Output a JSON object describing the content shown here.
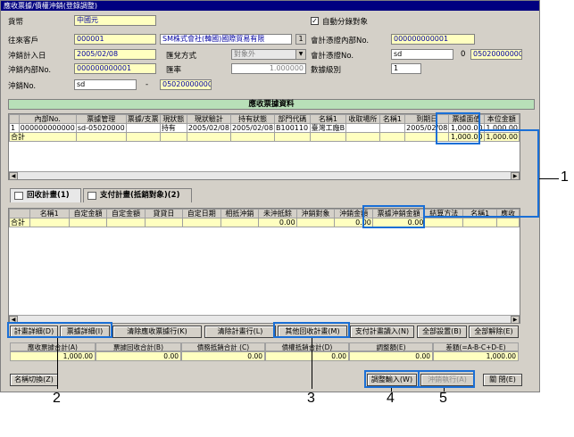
{
  "window": {
    "title": "應收票據/債權沖銷(登錄調整)"
  },
  "form": {
    "currency_label": "貨幣",
    "currency_value": "中國元",
    "auto_split_label": "自動分錄對象",
    "auto_split_checked": "✓",
    "client_label": "往來客戶",
    "client_code": "000001",
    "client_name": "SM株式會社(韓國)國際貿易有限",
    "accounting_no_label": "會計憑證內部No.",
    "accounting_no_value": "000000000001",
    "plan_date_label": "沖銷計入日",
    "plan_date_value": "2005/02/08",
    "exchange_method_label": "匯兌方式",
    "exchange_method_value": "對象外",
    "voucher_no_label": "會計憑證No.",
    "voucher_no_prefix": "sd",
    "voucher_sep": "0",
    "voucher_no_value": "050200000001",
    "write_off_no_label": "沖銷內部No.",
    "write_off_no_value": "000000000001",
    "rate_label": "匯率",
    "rate_value": "1.000000",
    "approval_label": "數據級別",
    "approval_value": "1",
    "offset_no_label": "沖銷No.",
    "offset_no_prefix": "sd",
    "offset_dash": "-",
    "offset_no_value": "050200000001"
  },
  "receivable": {
    "title": "應收票據資料",
    "headers": [
      "",
      "內部No.",
      "票據管理",
      "票據/支票",
      "現狀態",
      "現狀驗計",
      "持有狀態",
      "部門代碼",
      "名稱1",
      "收取場所",
      "名稱1",
      "到期日",
      "票據面值",
      "本位金額"
    ],
    "rows": [
      [
        "1",
        "000000000000",
        "sd-05020000",
        "",
        "持有",
        "2005/02/08",
        "2005/02/08",
        "B100110",
        "臺灣工廠B",
        "",
        "",
        "2005/02/08",
        "1,000.00",
        "1,000.00"
      ]
    ],
    "total_label": "合計",
    "total_face": "1,000.00",
    "total_base": "1,000.00"
  },
  "tabs": [
    {
      "label": "回收計畫(1)"
    },
    {
      "label": "支付計畫(抵銷對象)(2)"
    }
  ],
  "plan": {
    "headers": [
      "",
      "名稱1",
      "自定金額",
      "自定金額",
      "貸貸日",
      "自定日期",
      "相抵沖銷",
      "未沖抵餘",
      "沖銷對象",
      "沖銷金額",
      "票據沖銷金額",
      "結算方法",
      "名稱1",
      "應收"
    ],
    "total_label": "合計",
    "total_unwritten": "0.00",
    "total_writeoff": "0.00",
    "total_bill_writeoff": "0.00"
  },
  "buttons": {
    "plan_detail": "計畫詳細(D)",
    "bill_detail": "票據詳細(I)",
    "clear_bill_rows": "清除應收票據行(K)",
    "clear_plan_rows": "清除計畫行(L)",
    "other_collection": "其他回收計畫(M)",
    "payment_import": "支付計畫讀入(N)",
    "select_all": "全部設置(B)",
    "deselect_all": "全部解除(E)",
    "name_switch": "名稱切換(Z)",
    "adjust_input": "調整輸入(W)",
    "execute_offset": "沖銷執行(A)",
    "close": "關  閉(E)"
  },
  "summary": {
    "headers": [
      "應收票據合計(A)",
      "票據回收合計(B)",
      "債務抵銷合計 (C)",
      "債權抵銷合計(D)",
      "調整額(E)",
      "差額(=A-B-C+D-E)"
    ],
    "values": [
      "1,000.00",
      "0.00",
      "0.00",
      "0.00",
      "0.00",
      "1,000.00"
    ]
  },
  "callouts": [
    "1",
    "2",
    "3",
    "4",
    "5"
  ]
}
